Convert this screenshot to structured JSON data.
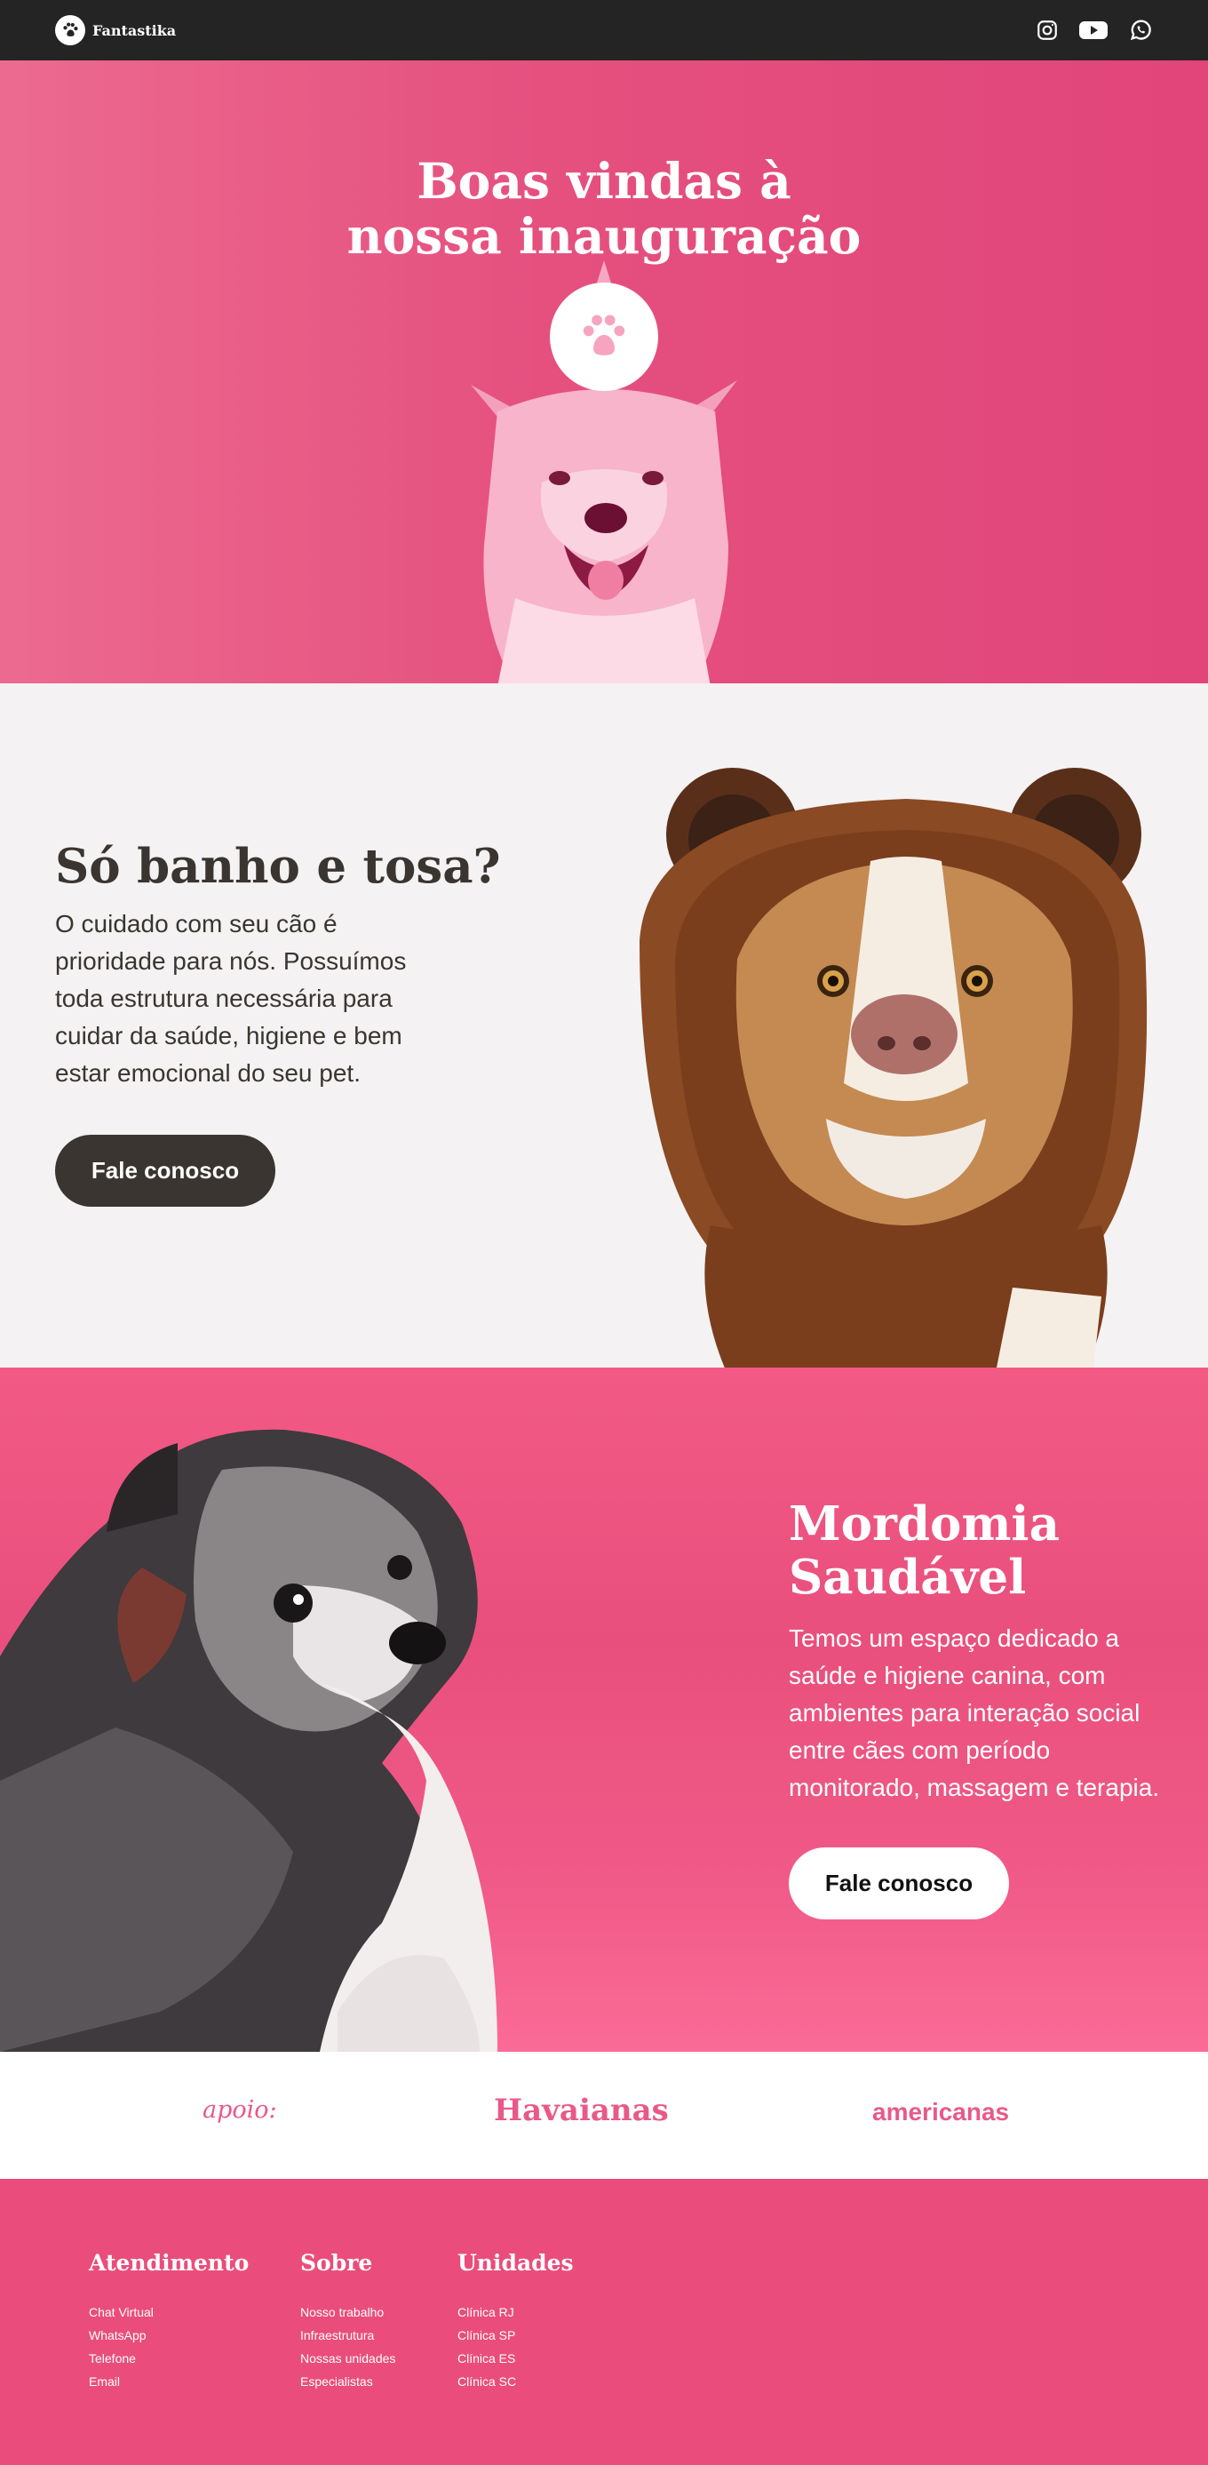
{
  "brand": {
    "name": "Fantastika"
  },
  "nav": {
    "social": [
      "instagram-icon",
      "youtube-icon",
      "whatsapp-icon"
    ]
  },
  "hero": {
    "title_line1": "Boas vindas à",
    "title_line2": "nossa inauguração"
  },
  "section2": {
    "title": "Só banho e tosa?",
    "text": "O cuidado com seu cão é prioridade para nós. Possuímos toda estrutura necessária para cuidar da saúde, higiene e bem estar emocional do seu pet.",
    "button": "Fale conosco"
  },
  "section3": {
    "title_line1": "Mordomia",
    "title_line2": "Saudável",
    "text": "Temos um espaço dedicado a saúde e higiene canina, com ambientes para interação social entre cães com período monitorado, massagem e terapia.",
    "button": "Fale conosco"
  },
  "sponsors": {
    "label": "apoio:",
    "items": [
      "Havaianas",
      "americanas"
    ]
  },
  "footer": {
    "columns": [
      {
        "title": "Atendimento",
        "links": [
          "Chat Virtual",
          "WhatsApp",
          "Telefone",
          "Email"
        ]
      },
      {
        "title": "Sobre",
        "links": [
          "Nosso trabalho",
          "Infraestrutura",
          "Nossas unidades",
          "Especialistas"
        ]
      },
      {
        "title": "Unidades",
        "links": [
          "Clínica RJ",
          "Clínica SP",
          "Clínica ES",
          "Clínica SC"
        ]
      }
    ]
  },
  "colors": {
    "nav": "#242424",
    "pink": "#e5507f",
    "dark": "#3a3530",
    "light_bg": "#f4f2f3"
  }
}
